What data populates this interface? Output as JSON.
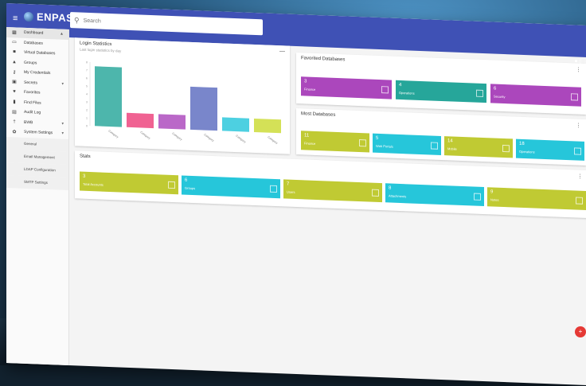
{
  "app": {
    "logo_text": "ENPAST"
  },
  "search": {
    "placeholder": "Search"
  },
  "sidebar": {
    "items": [
      {
        "label": "Dashboard",
        "icon": "dashboard-icon",
        "glyph": "▦",
        "active": true,
        "chevron": "▲"
      },
      {
        "label": "Databases",
        "icon": "database-icon",
        "glyph": "▭",
        "active": false,
        "chevron": ""
      },
      {
        "label": "Virtual Databases",
        "icon": "folder-icon",
        "glyph": "■",
        "active": false,
        "chevron": ""
      },
      {
        "label": "Groups",
        "icon": "group-icon",
        "glyph": "▲",
        "active": false,
        "chevron": ""
      },
      {
        "label": "My Credentials",
        "icon": "key-icon",
        "glyph": "⚷",
        "active": false,
        "chevron": ""
      },
      {
        "label": "Secrets",
        "icon": "lock-icon",
        "glyph": "▣",
        "active": false,
        "chevron": "▾"
      },
      {
        "label": "Favorites",
        "icon": "heart-icon",
        "glyph": "♥",
        "active": false,
        "chevron": ""
      },
      {
        "label": "Find Files",
        "icon": "file-icon",
        "glyph": "▮",
        "active": false,
        "chevron": ""
      },
      {
        "label": "Audit Log",
        "icon": "log-icon",
        "glyph": "▤",
        "active": false,
        "chevron": ""
      },
      {
        "label": "BWB",
        "icon": "pin-icon",
        "glyph": "†",
        "active": false,
        "chevron": "▾"
      },
      {
        "label": "System Settings",
        "icon": "gear-icon",
        "glyph": "✿",
        "active": false,
        "chevron": "▾"
      }
    ],
    "sub_items": [
      "General",
      "Email Management",
      "LDAP Configuration",
      "SMTP Settings"
    ]
  },
  "login_card": {
    "title": "Login Statistics",
    "subtitle": "Last login statistics by day"
  },
  "chart_data": {
    "type": "bar",
    "categories": [
      "Category",
      "Category",
      "Category",
      "Category",
      "Category",
      "Category"
    ],
    "values": [
      7.5,
      1.8,
      1.8,
      5.4,
      1.7,
      1.7
    ],
    "colors": [
      "#4db6ac",
      "#f06292",
      "#ba68c8",
      "#7986cb",
      "#4dd0e1",
      "#d4e157"
    ],
    "ylim": [
      0,
      8
    ]
  },
  "favorited_card": {
    "title": "Favorited Databases",
    "tiles": [
      {
        "num": "3",
        "label": "Finance",
        "color": "#ab47bc"
      },
      {
        "num": "4",
        "label": "Operations",
        "color": "#26a69a"
      },
      {
        "num": "6",
        "label": "Security",
        "color": "#ab47bc"
      }
    ]
  },
  "popular_card": {
    "title": "Most Databases",
    "tiles": [
      {
        "num": "11",
        "label": "Finance",
        "color": "#c0ca33"
      },
      {
        "num": "5",
        "label": "Web Portals",
        "color": "#26c6da"
      },
      {
        "num": "14",
        "label": "Mobile",
        "color": "#c0ca33"
      },
      {
        "num": "18",
        "label": "Operations",
        "color": "#26c6da"
      }
    ]
  },
  "stats_card": {
    "title": "Stats",
    "tiles": [
      {
        "num": "3",
        "label": "Total Accounts",
        "color": "#c0ca33"
      },
      {
        "num": "6",
        "label": "Groups",
        "color": "#26c6da"
      },
      {
        "num": "7",
        "label": "Users",
        "color": "#c0ca33"
      },
      {
        "num": "8",
        "label": "Attachments",
        "color": "#26c6da"
      },
      {
        "num": "9",
        "label": "Notes",
        "color": "#c0ca33"
      }
    ]
  },
  "topbar": {
    "right_text": "■ ▯ ⋮"
  }
}
